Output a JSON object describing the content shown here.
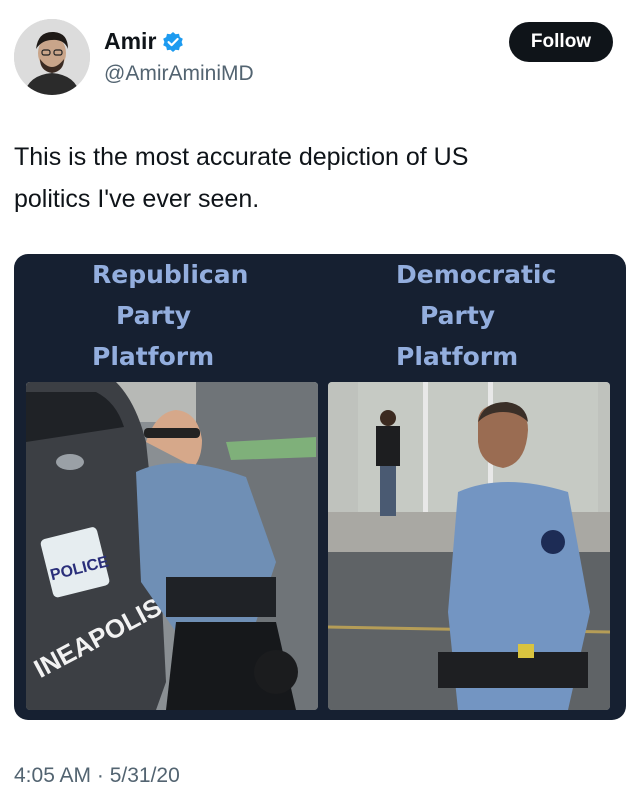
{
  "user": {
    "display_name": "Amir",
    "handle": "@AmirAminiMD",
    "verified_icon": "verified-badge-icon"
  },
  "follow_label": "Follow",
  "tweet": {
    "text_line1": "This is the most accurate depiction of US",
    "text_line2": "politics I've ever seen."
  },
  "meme": {
    "left_caption": [
      "Republican",
      "Party",
      "Platform"
    ],
    "right_caption": [
      "Democratic",
      "Party",
      "Platform"
    ],
    "plate_text": "POLICE",
    "vehicle_text": "INEAPOLIS"
  },
  "timestamp": "4:05 AM · 5/31/20",
  "colors": {
    "follow_bg": "#0f1419",
    "verified_blue": "#1d9bf0",
    "meme_bg": "#162031",
    "caption_color": "#93aede",
    "secondary_text": "#536471"
  }
}
